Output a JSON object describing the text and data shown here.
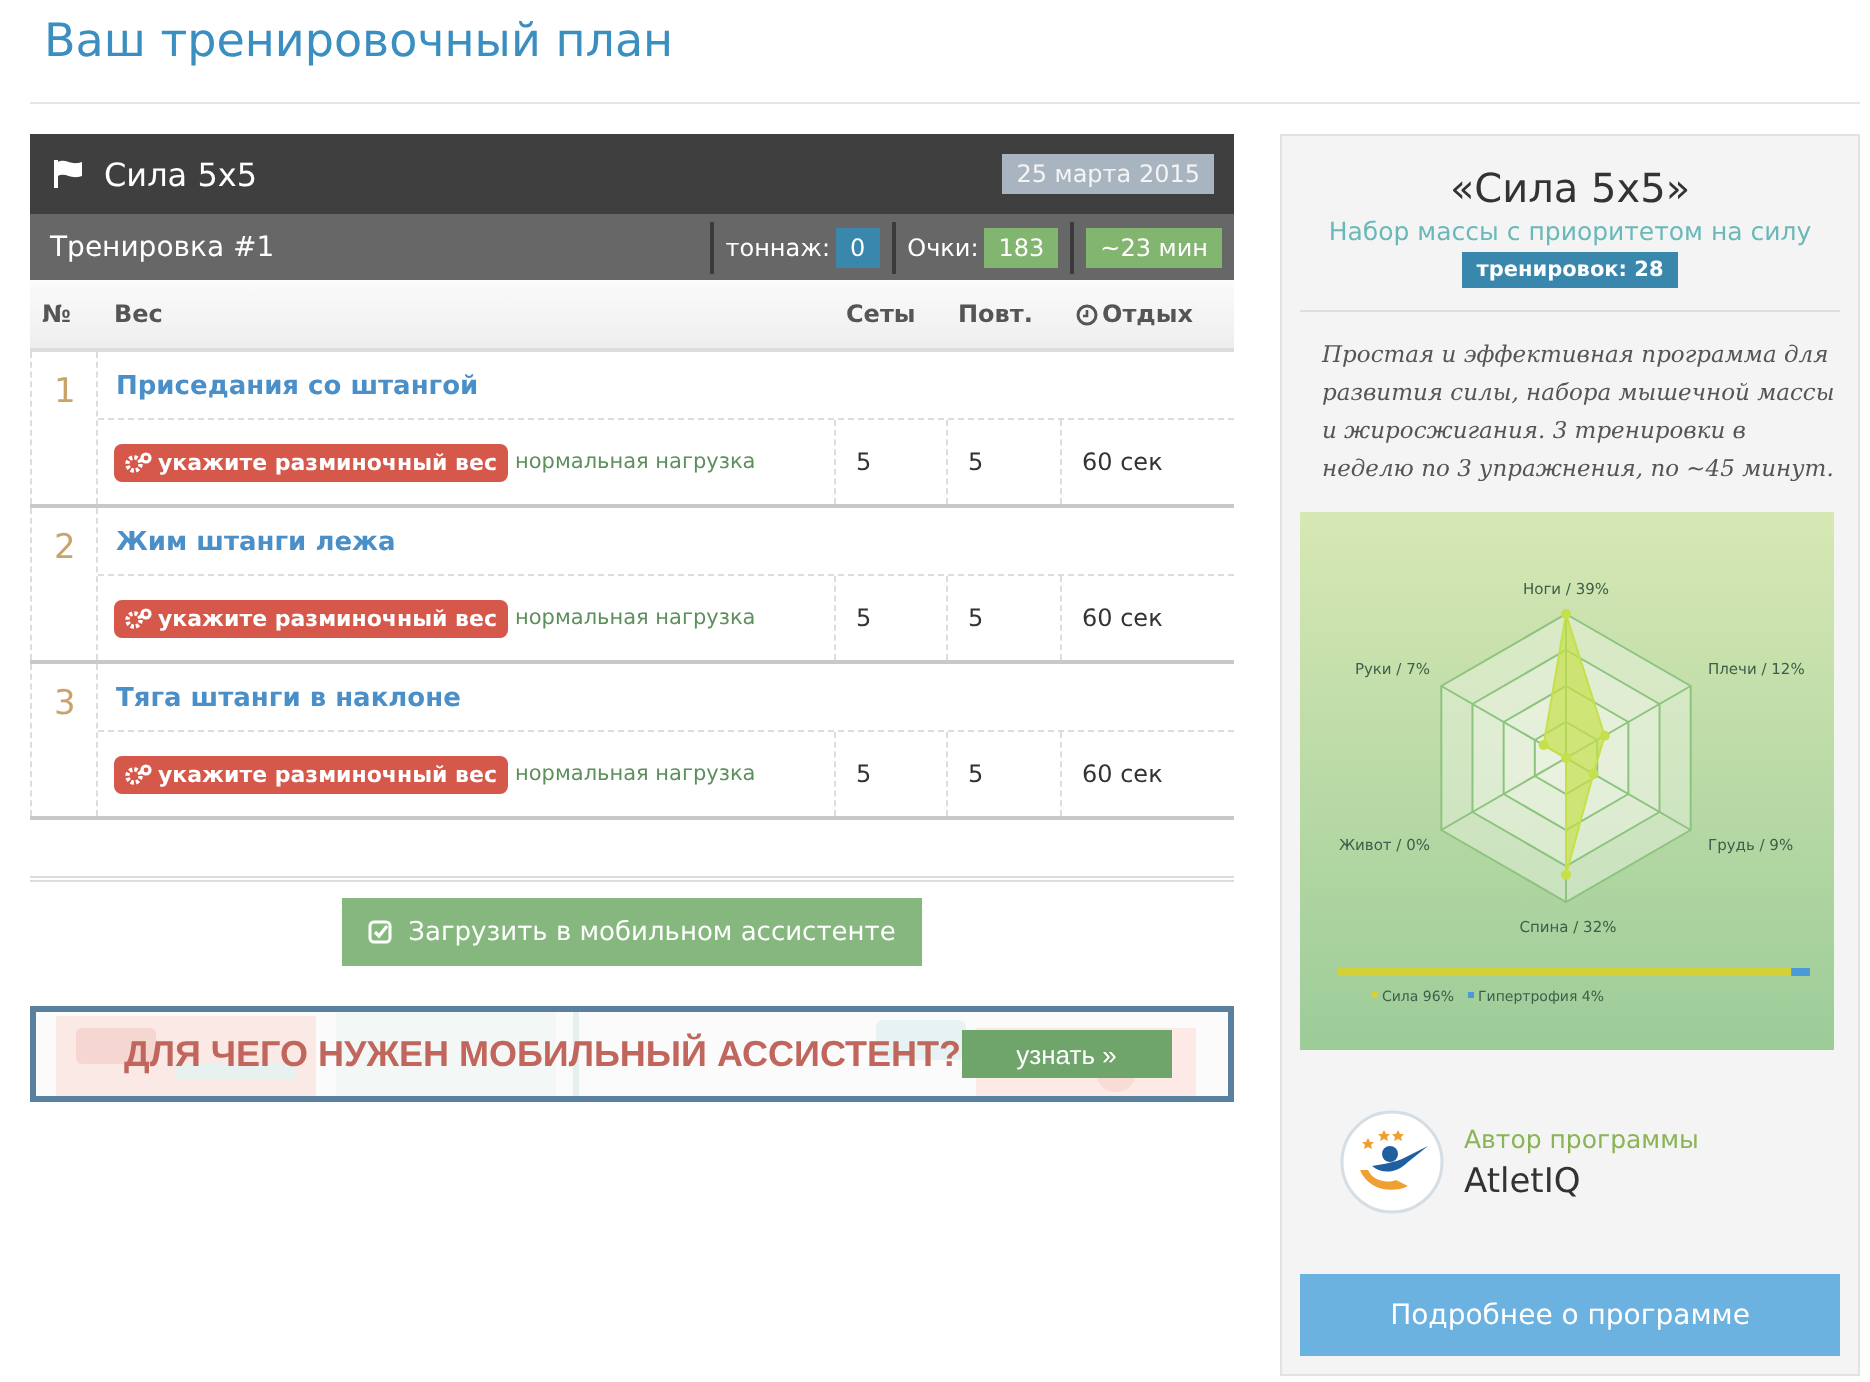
{
  "page_title": "Ваш тренировочный план",
  "plan": {
    "name": "Сила 5x5",
    "date": "25 марта 2015"
  },
  "workout": {
    "title": "Тренировка #1",
    "tonnage_label": "тоннаж:",
    "tonnage": "0",
    "points_label": "Очки:",
    "points": "183",
    "duration": "~23 мин"
  },
  "table": {
    "columns": [
      "№",
      "Вес",
      "Сеты",
      "Повт.",
      "Отдых"
    ],
    "rows": [
      {
        "number": "1",
        "exercise": "Приседания со штангой",
        "warmup": "укажите разминочный вес",
        "load": "нормальная нагрузка",
        "sets": "5",
        "reps": "5",
        "rest": "60 сек"
      },
      {
        "number": "2",
        "exercise": "Жим штанги лежа",
        "warmup": "укажите разминочный вес",
        "load": "нормальная нагрузка",
        "sets": "5",
        "reps": "5",
        "rest": "60 сек"
      },
      {
        "number": "3",
        "exercise": "Тяга штанги в наклоне",
        "warmup": "укажите разминочный вес",
        "load": "нормальная нагрузка",
        "sets": "5",
        "reps": "5",
        "rest": "60 сек"
      }
    ]
  },
  "download_button": "Загрузить в мобильном ассистенте",
  "banner": {
    "headline": "ДЛЯ ЧЕГО НУЖЕН МОБИЛЬНЫЙ АССИСТЕНТ?",
    "button": "узнать »"
  },
  "program": {
    "title": "«Сила 5x5»",
    "subtitle": "Набор массы с приоритетом на силу",
    "badge": "тренировок: 28",
    "description": "Простая и эффективная программа для развития силы, набора мышечной массы и жиросжигания. 3 тренировки в неделю по 3 упражнения, по ~45 минут.",
    "radar_labels": [
      "Ноги / 39%",
      "Плечи / 12%",
      "Грудь / 9%",
      "Спина / 32%",
      "Живот / 0%",
      "Руки / 7%"
    ],
    "focus": {
      "level": 0.96,
      "legend": [
        {
          "label": "Сила 96%",
          "color": "#d4d03a"
        },
        {
          "label": "Гипертрофия 4%",
          "color": "#4a9ad8"
        }
      ]
    },
    "author_label": "Автор программы",
    "author": "AtletIQ",
    "details_button": "Подробнее о программе"
  }
}
